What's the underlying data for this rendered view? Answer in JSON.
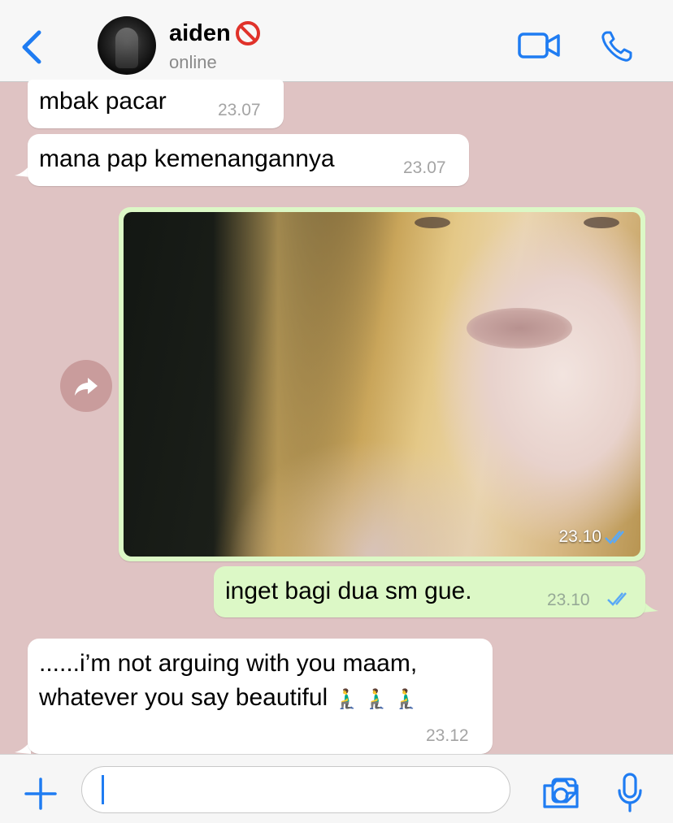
{
  "header": {
    "contact_name": "aiden",
    "status": "online"
  },
  "messages": [
    {
      "direction": "incoming",
      "text": "mbak pacar",
      "time": "23.07"
    },
    {
      "direction": "incoming",
      "text": "mana pap kemenangannya",
      "time": "23.07"
    },
    {
      "direction": "outgoing",
      "type": "photo",
      "time": "23.10",
      "read": true
    },
    {
      "direction": "outgoing",
      "text": "inget bagi dua sm gue.",
      "time": "23.10",
      "read": true
    },
    {
      "direction": "incoming",
      "line1": "......i’m not arguing with you maam,",
      "line2": "whatever you say beautiful",
      "emoji": "🧎‍♂️ 🧎‍♂️ 🧎‍♂️",
      "time": "23.12"
    }
  ],
  "input": {
    "value": ""
  },
  "colors": {
    "accent": "#1f7cf2",
    "chat_background": "#dfc3c3",
    "outgoing_bubble": "#dcf8c6",
    "incoming_bubble": "#ffffff"
  },
  "icons": [
    "chevron-left-icon",
    "block-icon",
    "video-camera-icon",
    "phone-icon",
    "forward-icon",
    "double-check-icon",
    "plus-icon",
    "sticker-icon",
    "camera-icon",
    "microphone-icon"
  ]
}
